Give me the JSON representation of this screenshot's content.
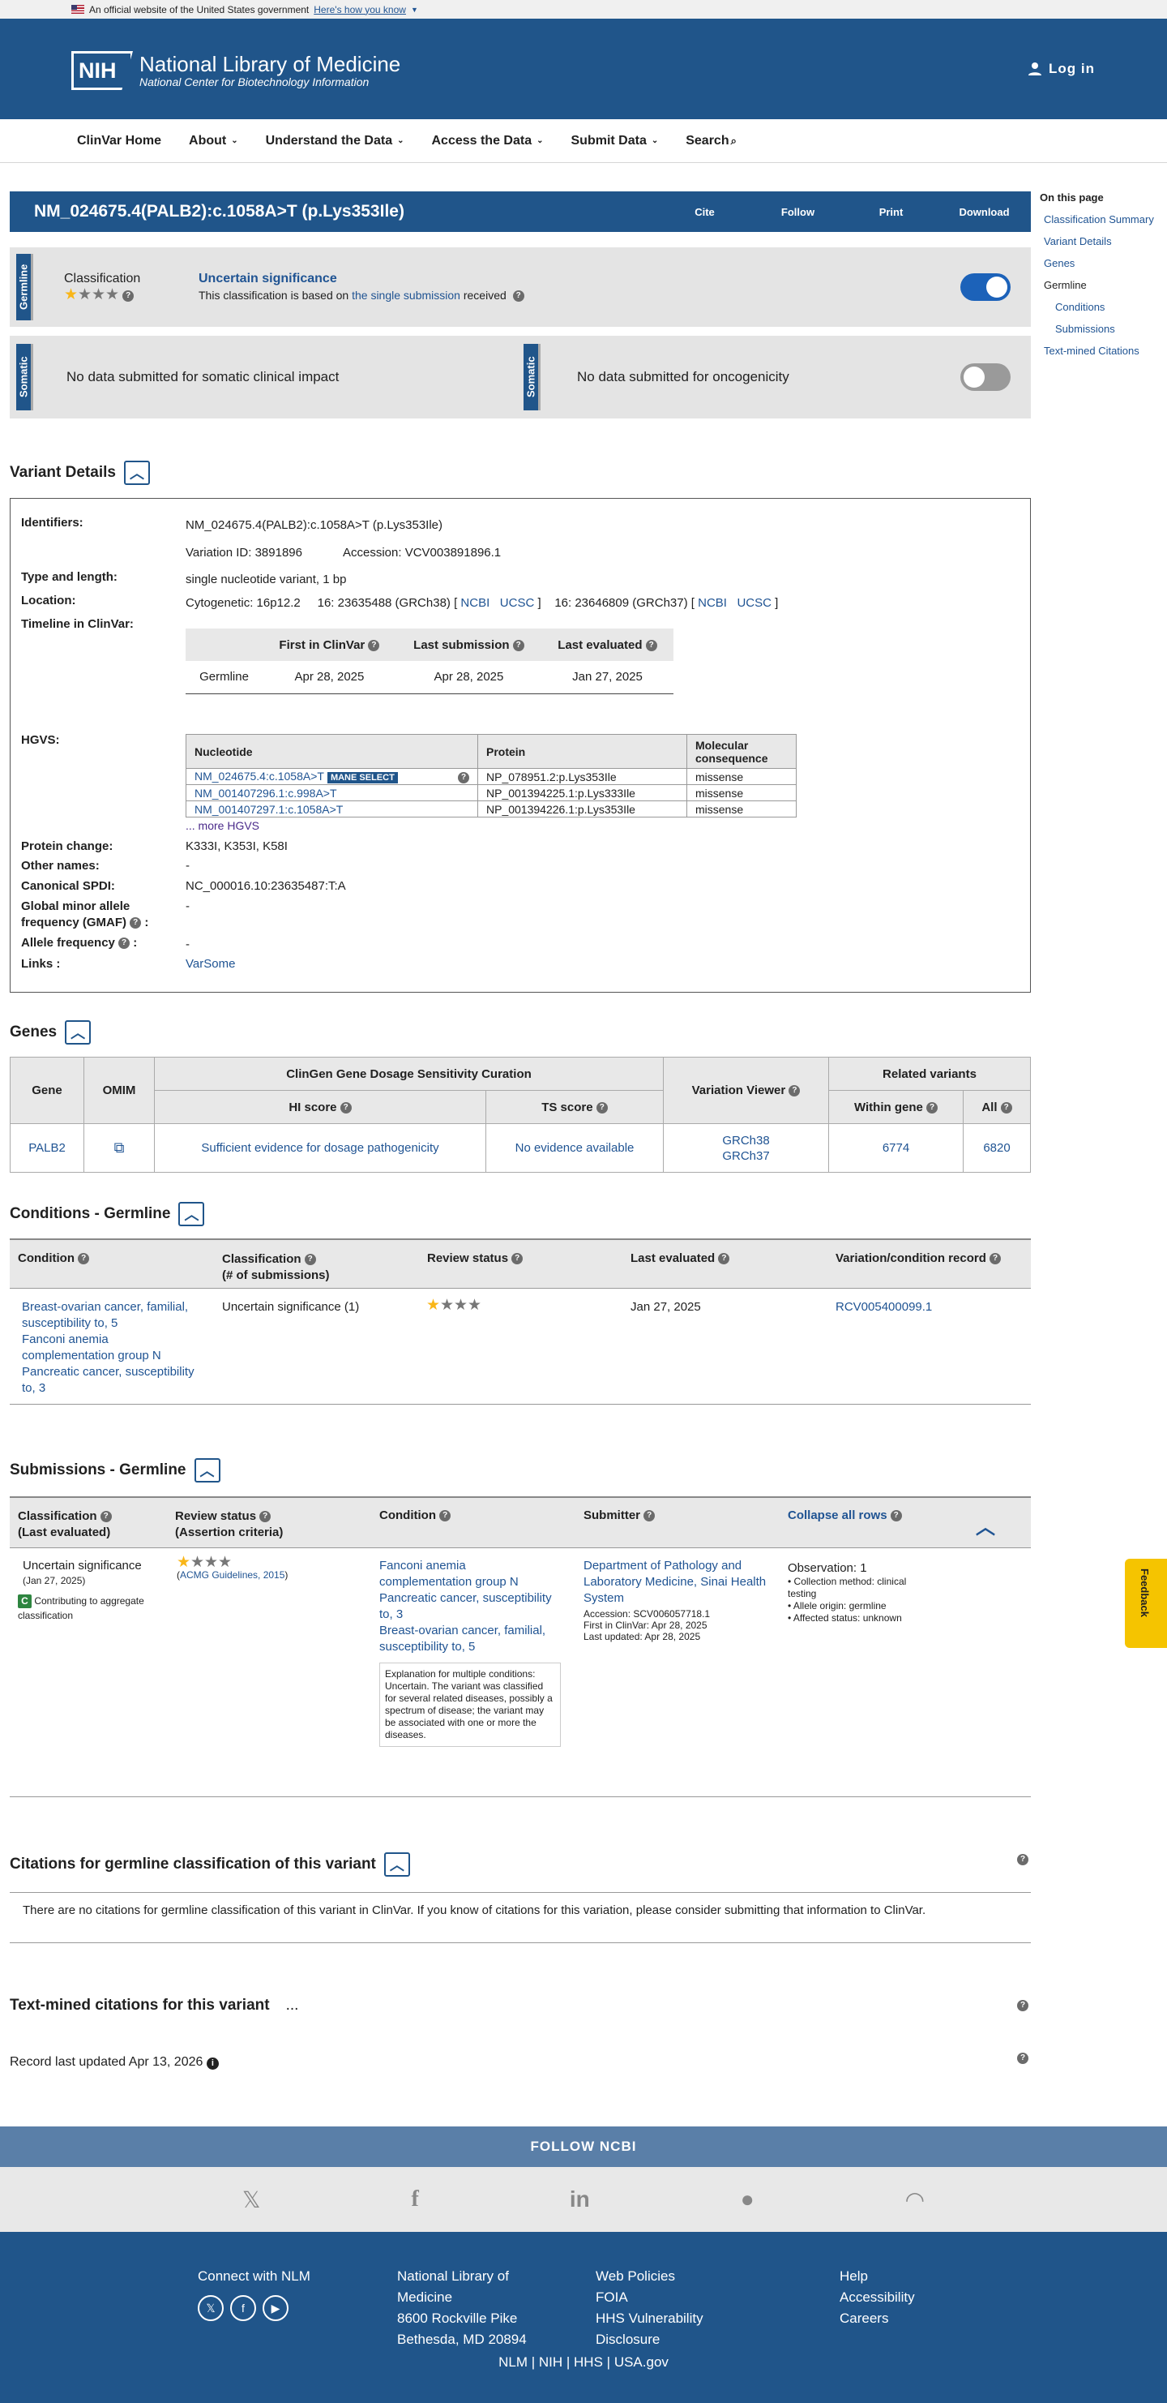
{
  "gov": {
    "text": "An official website of the United States government",
    "how": "Here's how you know"
  },
  "header": {
    "nih": "NIH",
    "title": "National Library of Medicine",
    "subtitle": "National Center for Biotechnology Information",
    "login": "Log in"
  },
  "nav": [
    "ClinVar Home",
    "About",
    "Understand the Data",
    "Access the Data",
    "Submit Data",
    "Search"
  ],
  "sidebar": {
    "title": "On this page",
    "items": [
      "Classification Summary",
      "Variant Details",
      "Genes",
      "Germline",
      "Conditions",
      "Submissions",
      "Text-mined Citations"
    ]
  },
  "titlebar": {
    "title": "NM_024675.4(PALB2):c.1058A>T (p.Lys353Ile)",
    "actions": [
      "Cite",
      "Follow",
      "Print",
      "Download"
    ]
  },
  "germline": {
    "tab": "Germline",
    "label": "Classification",
    "stars": 1,
    "sig": "Uncertain significance",
    "basis_pre": "This classification is based on",
    "basis_link": "the single submission",
    "basis_post": "received"
  },
  "somatic": {
    "tab": "Somatic",
    "left": "No data submitted for somatic clinical impact",
    "right": "No data submitted for oncogenicity"
  },
  "variant": {
    "heading": "Variant Details",
    "identifiers_label": "Identifiers:",
    "identifier": "NM_024675.4(PALB2):c.1058A>T (p.Lys353Ile)",
    "variation_id": "Variation ID: 3891896",
    "accession": "Accession: VCV003891896.1",
    "type_label": "Type and length:",
    "type": "single nucleotide variant, 1 bp",
    "location_label": "Location:",
    "cytogenetic": "Cytogenetic: 16p12.2",
    "loc38": "16: 23635488 (GRCh38) [",
    "loc37": "16: 23646809 (GRCh37) [",
    "ncbi": "NCBI",
    "ucsc": "UCSC",
    "close": "]",
    "timeline_label": "Timeline in ClinVar:",
    "timeline_headers": [
      "First in ClinVar",
      "Last submission",
      "Last evaluated"
    ],
    "timeline_row": [
      "Germline",
      "Apr 28, 2025",
      "Apr 28, 2025",
      "Jan 27, 2025"
    ],
    "hgvs_label": "HGVS:",
    "hgvs_headers": [
      "Nucleotide",
      "Protein",
      "Molecular consequence"
    ],
    "hgvs_rows": [
      [
        "NM_024675.4:c.1058A>T",
        "NP_078951.2:p.Lys353Ile",
        "missense"
      ],
      [
        "NM_001407296.1:c.998A>T",
        "NP_001394225.1:p.Lys333Ile",
        "missense"
      ],
      [
        "NM_001407297.1:c.1058A>T",
        "NP_001394226.1:p.Lys353Ile",
        "missense"
      ]
    ],
    "mane": "MANE SELECT",
    "more_hgvs": "... more HGVS",
    "protein_change_label": "Protein change:",
    "protein_change": "K333I, K353I, K58I",
    "other_names_label": "Other names:",
    "other_names": "-",
    "spdi_label": "Canonical SPDI:",
    "spdi": "NC_000016.10:23635487:T:A",
    "gmaf_label": "Global minor allele frequency (GMAF)",
    "gmaf_colon": ":",
    "gmaf": "-",
    "af_label": "Allele frequency",
    "af": "-",
    "links_label": "Links :",
    "links": "VarSome"
  },
  "genes": {
    "heading": "Genes",
    "h_gene": "Gene",
    "h_omim": "OMIM",
    "h_clingen": "ClinGen Gene Dosage Sensitivity Curation",
    "h_hi": "HI score",
    "h_ts": "TS score",
    "h_viewer": "Variation Viewer",
    "h_related": "Related variants",
    "h_within": "Within gene",
    "h_all": "All",
    "gene": "PALB2",
    "hi": "Sufficient evidence for dosage pathogenicity",
    "ts": "No evidence available",
    "grch38": "GRCh38",
    "grch37": "GRCh37",
    "within": "6774",
    "all": "6820"
  },
  "conditions": {
    "heading": "Conditions - Germline",
    "headers": [
      "Condition",
      "Classification",
      "(# of submissions)",
      "Review status",
      "Last evaluated",
      "Variation/condition record"
    ],
    "conds": [
      "Breast-ovarian cancer, familial, susceptibility to, 5",
      "Fanconi anemia complementation group N",
      "Pancreatic cancer, susceptibility to, 3"
    ],
    "classification": "Uncertain significance (1)",
    "last_eval": "Jan 27, 2025",
    "record": "RCV005400099.1"
  },
  "submissions": {
    "heading": "Submissions - Germline",
    "headers": [
      "Classification",
      "(Last evaluated)",
      "Review status",
      "(Assertion criteria)",
      "Condition",
      "Submitter",
      "Collapse all rows"
    ],
    "classification": "Uncertain significance",
    "date": "(Jan 27, 2025)",
    "contrib_badge": "C",
    "contrib": "Contributing to aggregate classification",
    "acmg": "ACMG Guidelines, 2015",
    "conds": [
      "Fanconi anemia complementation group N",
      "Pancreatic cancer, susceptibility to, 3",
      "Breast-ovarian cancer, familial, susceptibility to, 5"
    ],
    "explanation": "Explanation for multiple conditions: Uncertain. The variant was classified for several related diseases, possibly a spectrum of disease; the variant may be associated with one or more the diseases.",
    "submitter": "Department of Pathology and Laboratory Medicine, Sinai Health System",
    "sub_accession": "Accession: SCV006057718.1",
    "first": "First in ClinVar: Apr 28, 2025",
    "updated": "Last updated: Apr 28, 2025",
    "obs": "Observation: 1",
    "obs_items": [
      "Collection method: clinical testing",
      "Allele origin: germline",
      "Affected status: unknown"
    ]
  },
  "citations": {
    "heading": "Citations for germline classification of this variant",
    "text": "There are no citations for germline classification of this variant in ClinVar. If you know of citations for this variation, please consider submitting that information to ClinVar."
  },
  "textmined": {
    "heading": "Text-mined citations for this variant",
    "dots": "..."
  },
  "record": "Record last updated Apr 13, 2026",
  "feedback": "Feedback",
  "footer": {
    "follow": "FOLLOW NCBI",
    "connect": "Connect with NLM",
    "nlm": [
      "National Library of",
      "Medicine",
      "8600 Rockville Pike",
      "Bethesda, MD 20894"
    ],
    "col3": [
      "Web Policies",
      "FOIA",
      "HHS Vulnerability",
      "Disclosure"
    ],
    "col4": [
      "Help",
      "Accessibility",
      "Careers"
    ],
    "bottom": [
      "NLM",
      "NIH",
      "HHS",
      "USA.gov"
    ]
  },
  "colors": {
    "brand": "#20558a",
    "link": "#205493",
    "star": "#f9b618",
    "badge": "#2e8540"
  }
}
